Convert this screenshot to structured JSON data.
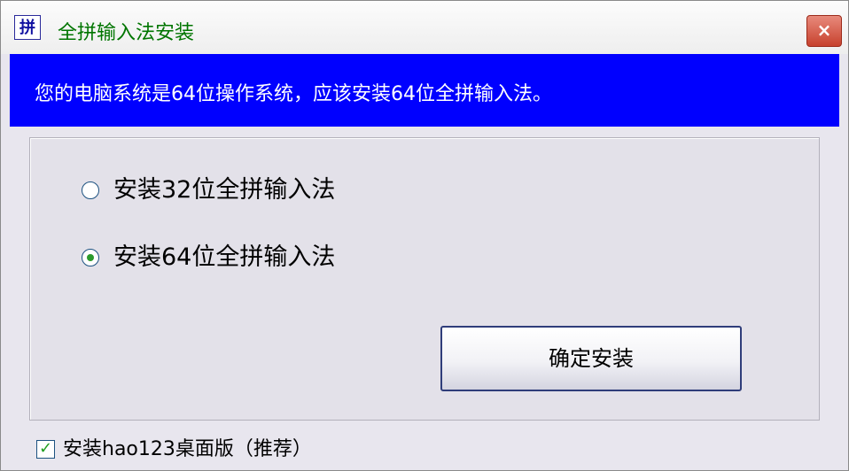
{
  "window": {
    "icon_text": "拼",
    "title": "全拼输入法安装",
    "close_symbol": "×"
  },
  "banner": {
    "text": "您的电脑系统是64位操作系统，应该安装64位全拼输入法。"
  },
  "options": [
    {
      "label": "安装32位全拼输入法",
      "selected": false
    },
    {
      "label": "安装64位全拼输入法",
      "selected": true
    }
  ],
  "confirm_button": {
    "label": "确定安装"
  },
  "footer_checkbox": {
    "label": "安装hao123桌面版（推荐）",
    "checked": true,
    "check_symbol": "✓"
  },
  "colors": {
    "title_text": "#007500",
    "banner_bg": "#0000ff",
    "banner_text": "#ffffff",
    "close_button": "#c7412d",
    "radio_dot": "#2b9a2b",
    "check_mark": "#1f9e1f"
  }
}
